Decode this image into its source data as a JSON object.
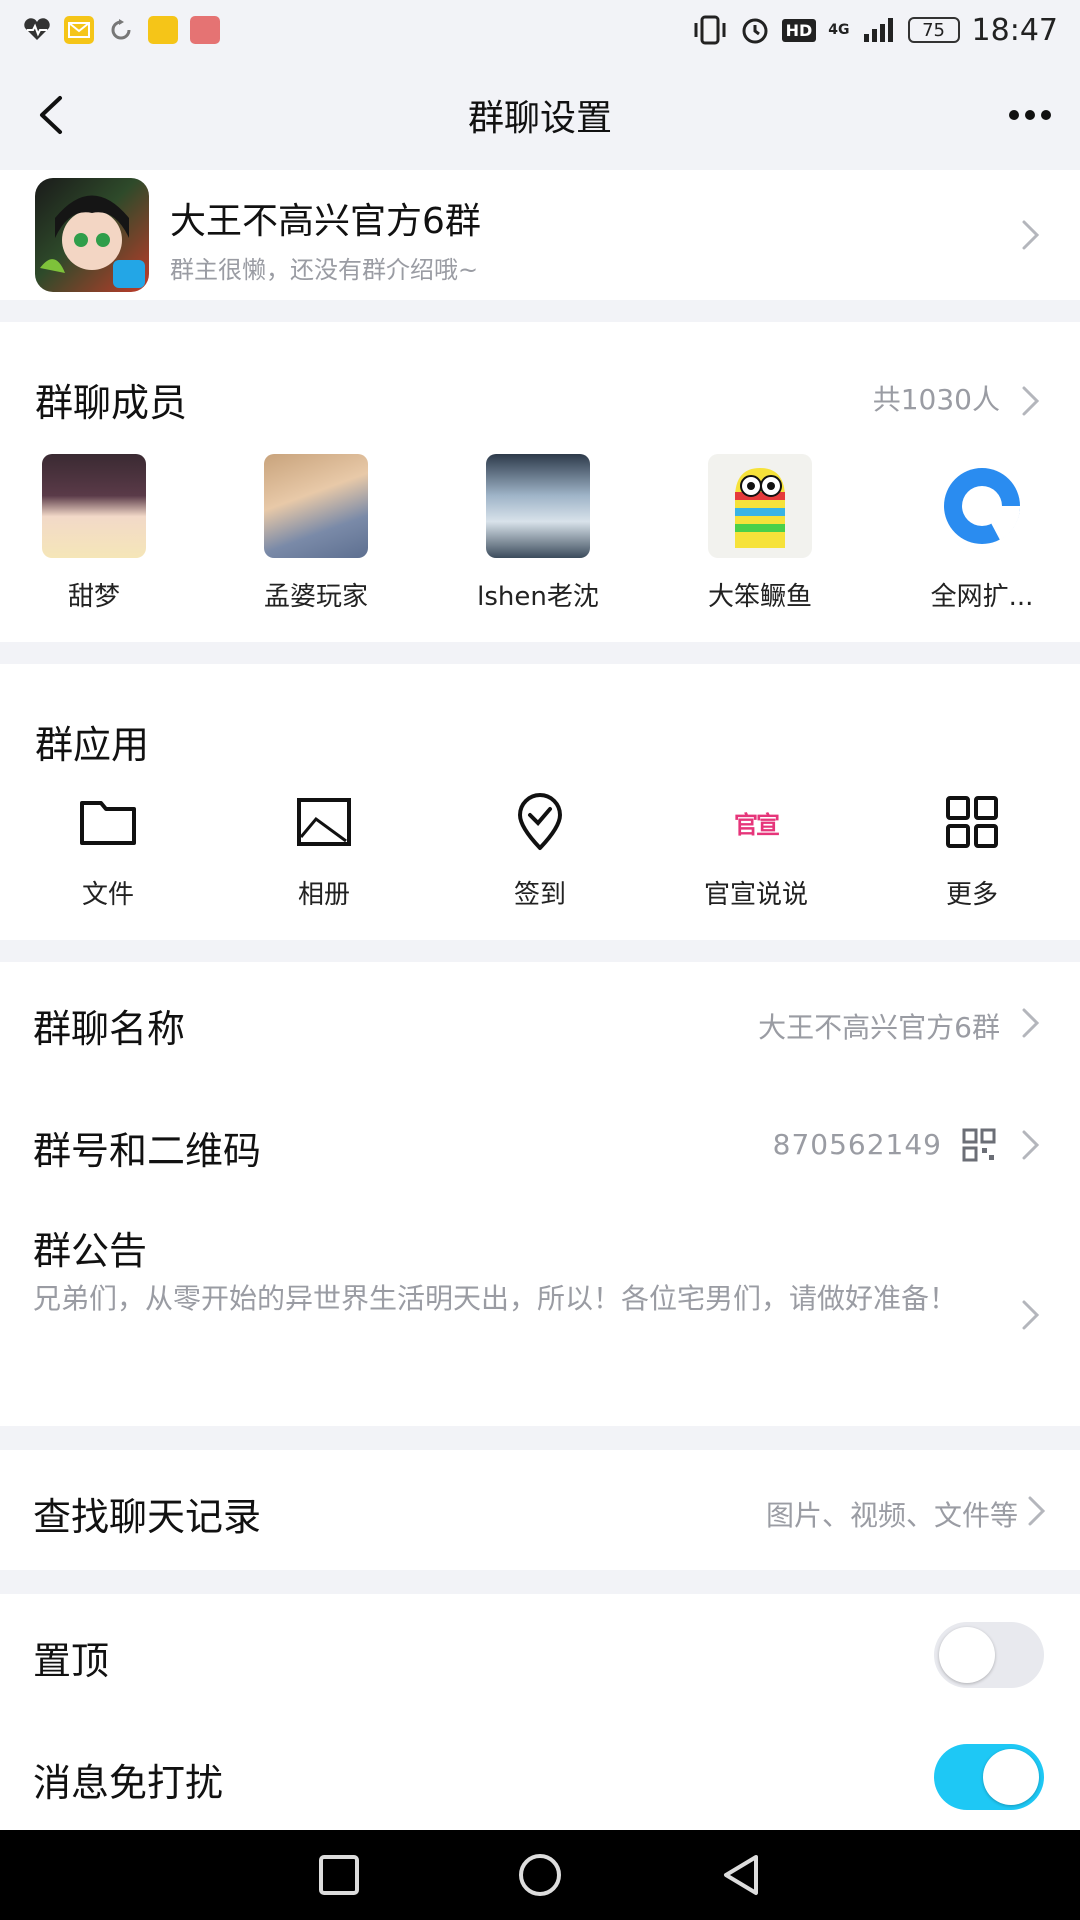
{
  "status_bar": {
    "time": "18:47",
    "battery": "75",
    "network": "4G",
    "hd": "HD",
    "left_icons": [
      "heart-rate-icon",
      "mail-icon",
      "sync-icon",
      "news-icon",
      "app-icon"
    ]
  },
  "nav": {
    "title": "群聊设置"
  },
  "group": {
    "name": "大王不高兴官方6群",
    "intro": "群主很懒，还没有群介绍哦~"
  },
  "members": {
    "title": "群聊成员",
    "count": "共1030人",
    "list": [
      {
        "name": "甜梦"
      },
      {
        "name": "孟婆玩家"
      },
      {
        "name": "lshen老沈"
      },
      {
        "name": "大笨鳜鱼"
      },
      {
        "name": "全网扩..."
      }
    ]
  },
  "apps": {
    "title": "群应用",
    "list": [
      {
        "label": "文件",
        "icon": "folder-icon"
      },
      {
        "label": "相册",
        "icon": "album-icon"
      },
      {
        "label": "签到",
        "icon": "checkin-icon"
      },
      {
        "label": "官宣说说",
        "icon": "announcement-badge-icon",
        "icon_text": "官宣"
      },
      {
        "label": "更多",
        "icon": "grid-icon"
      }
    ]
  },
  "info": {
    "name_label": "群聊名称",
    "name_value": "大王不高兴官方6群",
    "number_label": "群号和二维码",
    "number_value": "870562149",
    "notice_label": "群公告",
    "notice_text": "兄弟们，从零开始的异世界生活明天出，所以！各位宅男们，请做好准备！"
  },
  "search": {
    "label": "查找聊天记录",
    "hint": "图片、视频、文件等"
  },
  "toggles": {
    "pin_label": "置顶",
    "pin_on": false,
    "mute_label": "消息免打扰",
    "mute_on": true
  },
  "colors": {
    "accent": "#1ec8f5",
    "toggle_off": "#e8e9ee",
    "secondary_text": "#9a9ca3",
    "app_pink": "#e6357a"
  }
}
